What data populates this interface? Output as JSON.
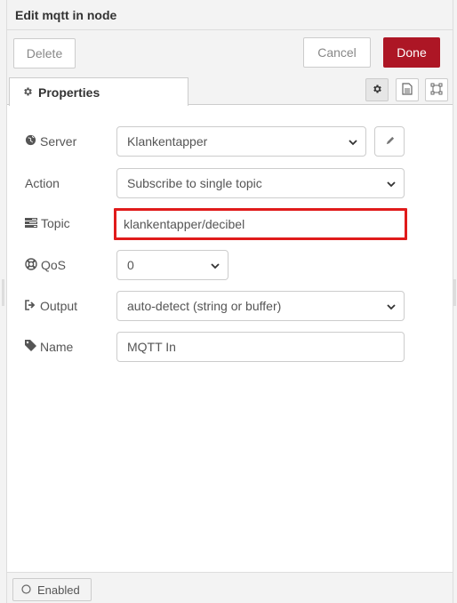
{
  "header": {
    "title": "Edit mqtt in node"
  },
  "toolbar": {
    "delete_label": "Delete",
    "cancel_label": "Cancel",
    "done_label": "Done"
  },
  "tabs": {
    "properties_label": "Properties"
  },
  "tab_icons": [
    "gear-icon",
    "description-icon",
    "appearance-icon"
  ],
  "form": {
    "server": {
      "label": "Server",
      "value": "Klankentapper",
      "icon": "globe-icon"
    },
    "action": {
      "label": "Action",
      "value": "Subscribe to single topic"
    },
    "topic": {
      "label": "Topic",
      "value": "klankentapper/decibel",
      "icon": "tasks-icon"
    },
    "qos": {
      "label": "QoS",
      "value": "0",
      "icon": "life-ring-icon"
    },
    "output": {
      "label": "Output",
      "value": "auto-detect (string or buffer)",
      "icon": "sign-out-icon"
    },
    "name": {
      "label": "Name",
      "value": "MQTT In",
      "icon": "tag-icon"
    }
  },
  "footer": {
    "enabled_label": "Enabled"
  },
  "colors": {
    "done": "#ad1625",
    "highlight": "#e01b1b",
    "background": "#f3f3f3"
  }
}
